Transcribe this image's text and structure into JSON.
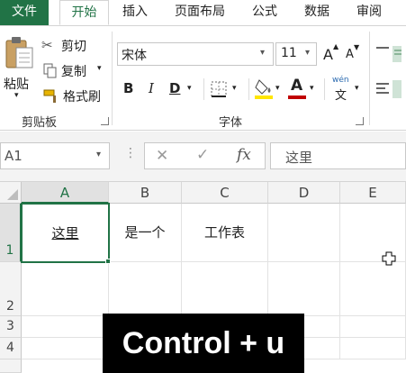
{
  "tabs": {
    "file": "文件",
    "home": "开始",
    "insert": "插入",
    "page_layout": "页面布局",
    "formulas": "公式",
    "data": "数据",
    "review": "审阅"
  },
  "clipboard": {
    "paste": "粘贴",
    "cut": "剪切",
    "copy": "复制",
    "format_painter": "格式刷",
    "group_label": "剪贴板"
  },
  "font": {
    "name": "宋体",
    "size": "11",
    "group_label": "字体",
    "bold": "B",
    "italic": "I",
    "underline": "D",
    "grow": "A",
    "shrink": "A",
    "wen_top": "wén",
    "wen_bottom": "文",
    "fill_color": "#ffe600",
    "font_color": "#c00000"
  },
  "formula_bar": {
    "name_box": "A1",
    "cancel": "✕",
    "enter": "✓",
    "fx": "fx",
    "content": "这里"
  },
  "grid": {
    "columns": [
      "A",
      "B",
      "C",
      "D",
      "E"
    ],
    "rows": [
      "1",
      "2",
      "3",
      "4"
    ],
    "cells": {
      "A1": "这里",
      "B1": "是一个",
      "C1": "工作表"
    }
  },
  "overlay": "Control + u",
  "colors": {
    "accent": "#217346"
  }
}
